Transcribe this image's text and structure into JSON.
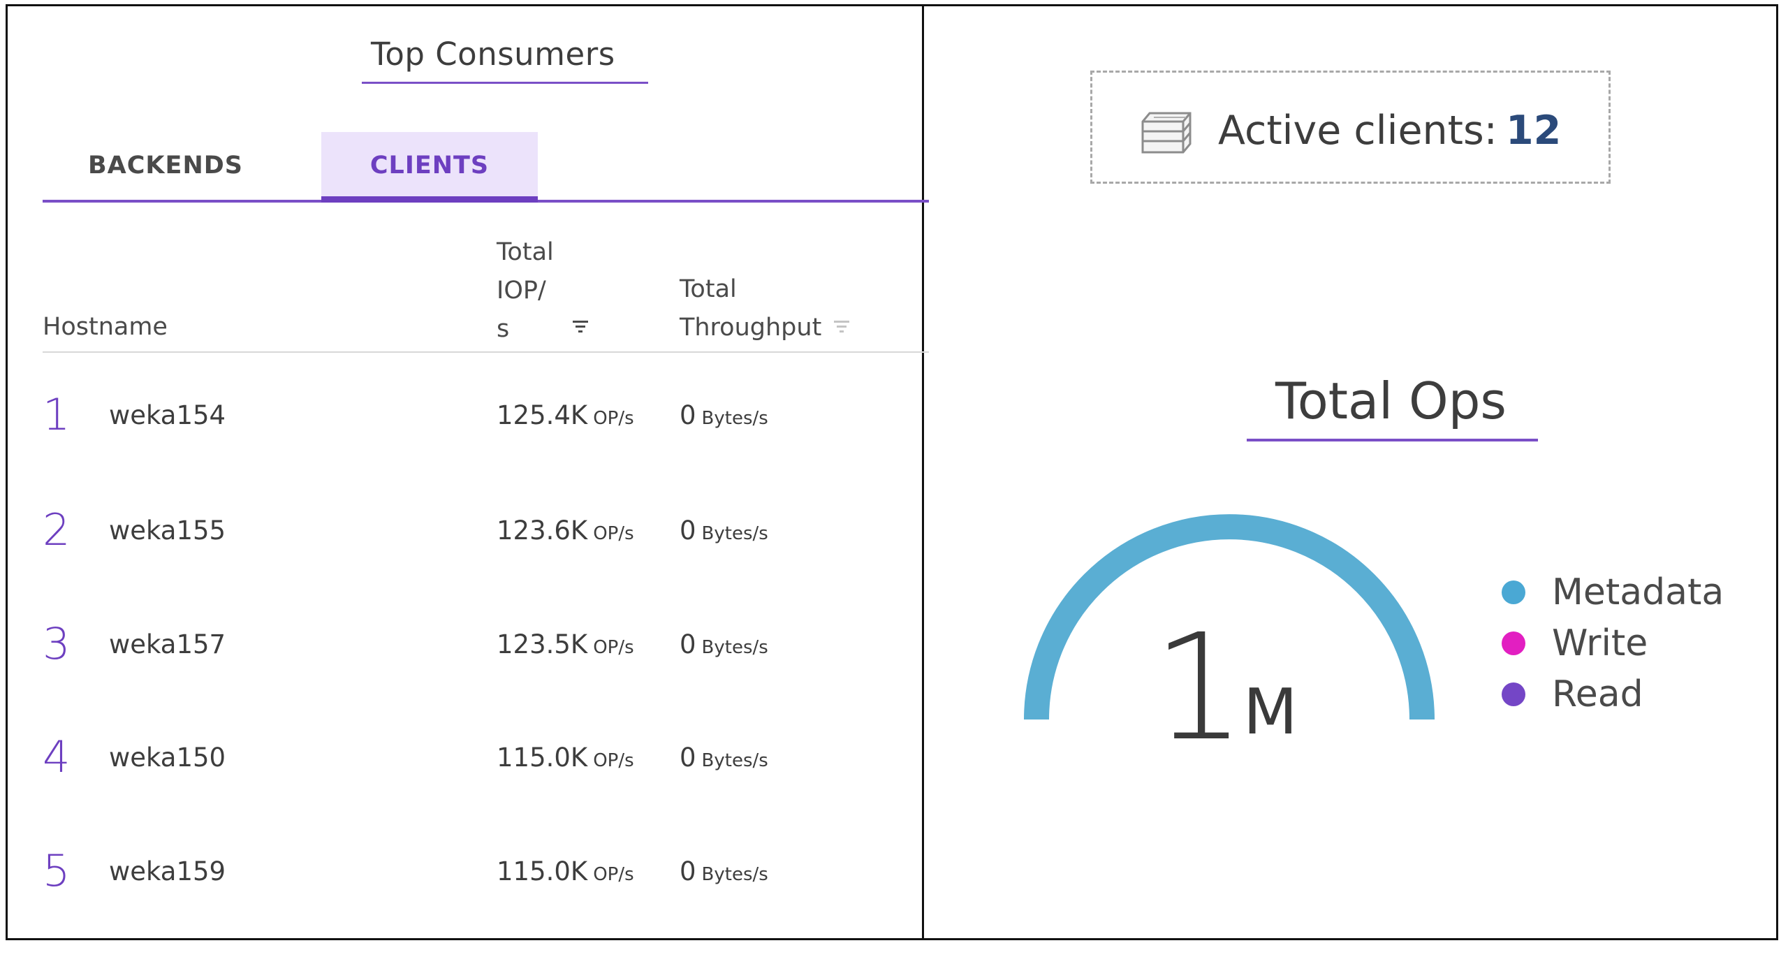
{
  "top_consumers": {
    "title": "Top Consumers",
    "tabs": [
      {
        "label": "BACKENDS",
        "active": false
      },
      {
        "label": "CLIENTS",
        "active": true
      }
    ],
    "columns": {
      "hostname": "Hostname",
      "iops_line1": "Total",
      "iops_line2": "IOP/",
      "iops_line3": "s",
      "throughput_line1": "Total",
      "throughput_line2": "Throughput"
    },
    "rows": [
      {
        "rank": "1",
        "host": "weka154",
        "iops": "125.4K",
        "iops_unit": "OP/s",
        "throughput": "0",
        "throughput_unit": "Bytes/s"
      },
      {
        "rank": "2",
        "host": "weka155",
        "iops": "123.6K",
        "iops_unit": "OP/s",
        "throughput": "0",
        "throughput_unit": "Bytes/s"
      },
      {
        "rank": "3",
        "host": "weka157",
        "iops": "123.5K",
        "iops_unit": "OP/s",
        "throughput": "0",
        "throughput_unit": "Bytes/s"
      },
      {
        "rank": "4",
        "host": "weka150",
        "iops": "115.0K",
        "iops_unit": "OP/s",
        "throughput": "0",
        "throughput_unit": "Bytes/s"
      },
      {
        "rank": "5",
        "host": "weka159",
        "iops": "115.0K",
        "iops_unit": "OP/s",
        "throughput": "0",
        "throughput_unit": "Bytes/s"
      }
    ],
    "icons": {
      "iops_sort": "sort-filter-icon-active",
      "throughput_sort": "sort-filter-icon-inactive"
    }
  },
  "active_clients": {
    "icon": "servers-stack-icon",
    "label": "Active clients:",
    "value": "12"
  },
  "total_ops": {
    "title": "Total Ops",
    "value": "1",
    "unit": "M",
    "gauge_color": "#5aaed3",
    "legend": [
      {
        "label": "Metadata",
        "color": "#4aa8d4"
      },
      {
        "label": "Write",
        "color": "#e21fc1"
      },
      {
        "label": "Read",
        "color": "#7446c6"
      }
    ]
  },
  "colors": {
    "accent": "#6d3fc0",
    "tab_active_bg": "#ece3fb",
    "active_value": "#2b4a7a"
  }
}
